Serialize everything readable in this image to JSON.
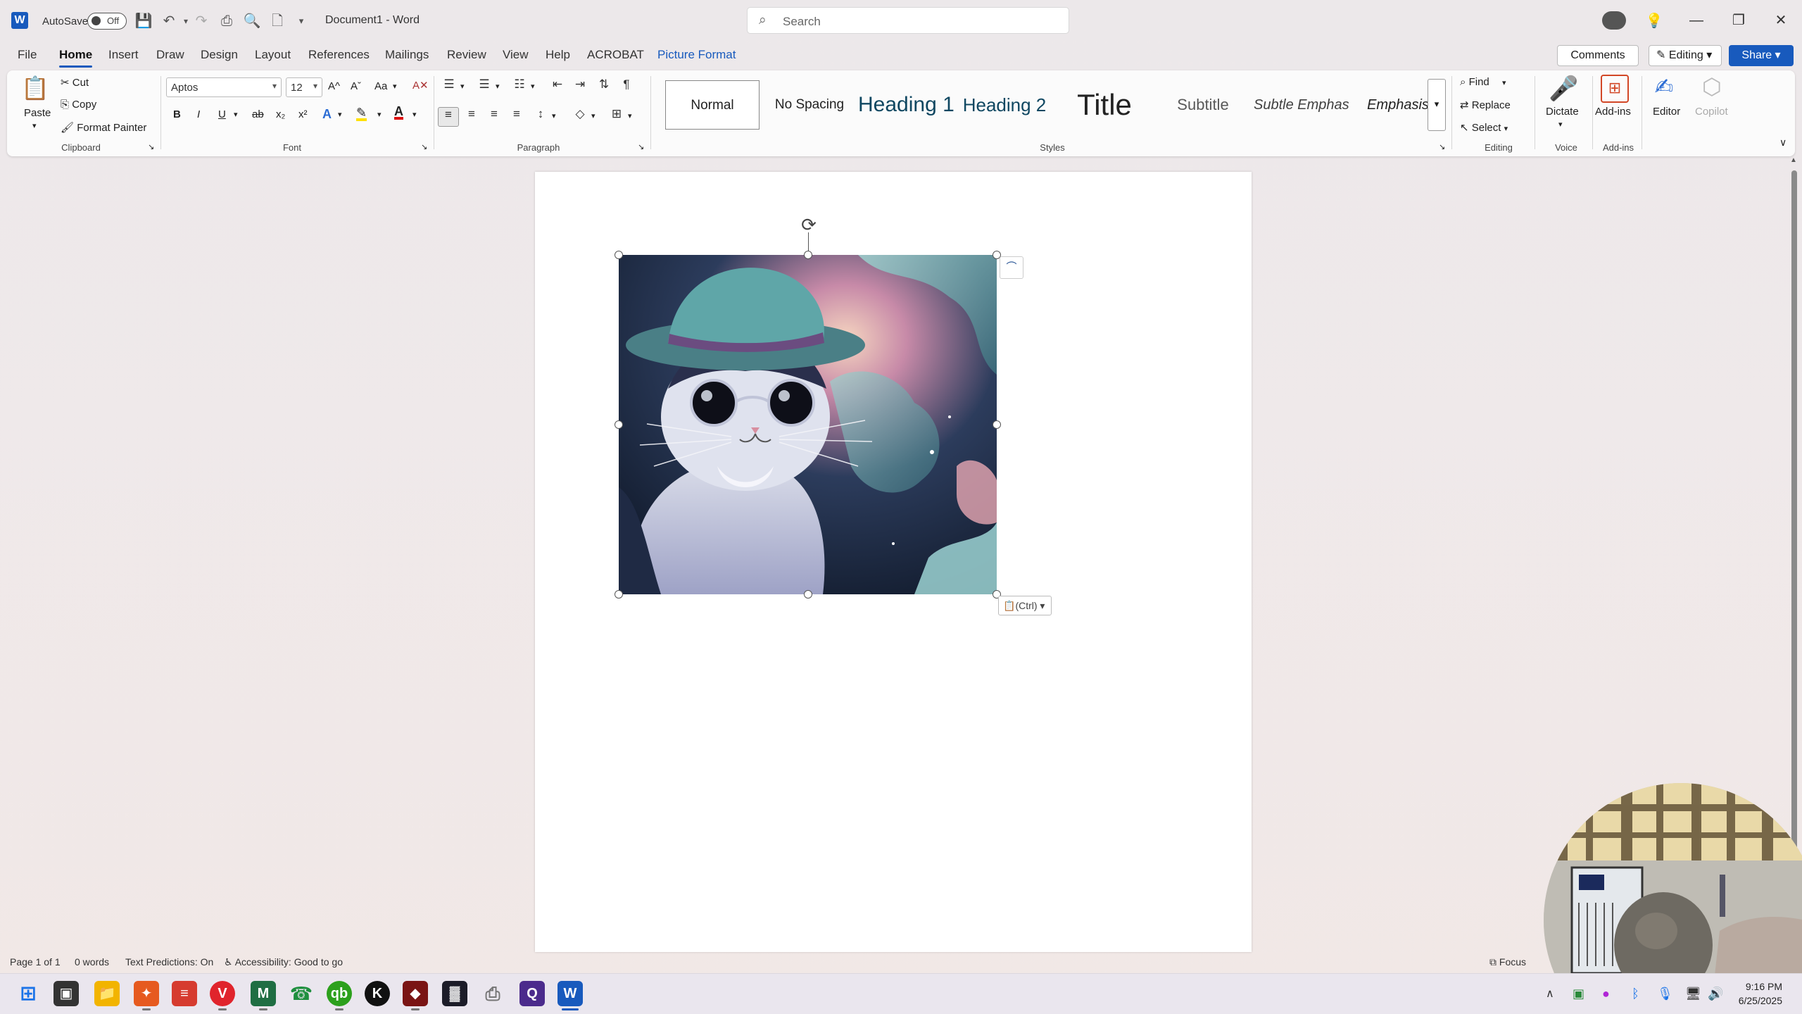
{
  "titlebar": {
    "autosave_label": "AutoSave",
    "autosave_state": "Off",
    "doc_title": "Document1  -  Word",
    "search_placeholder": "Search"
  },
  "menu": {
    "tabs": [
      "File",
      "Home",
      "Insert",
      "Draw",
      "Design",
      "Layout",
      "References",
      "Mailings",
      "Review",
      "View",
      "Help",
      "ACROBAT",
      "Picture Format"
    ],
    "active_tab": "Home",
    "comments": "Comments",
    "editing": "Editing",
    "share": "Share"
  },
  "ribbon": {
    "clipboard": {
      "paste": "Paste",
      "cut": "Cut",
      "copy": "Copy",
      "format_painter": "Format Painter",
      "label": "Clipboard"
    },
    "font": {
      "name": "Aptos",
      "size": "12",
      "label": "Font",
      "bold": "B",
      "italic": "I",
      "underline": "U",
      "strike": "ab",
      "sub": "x₂",
      "sup": "x²",
      "grow": "A^",
      "shrink": "Aˇ",
      "case": "Aa"
    },
    "paragraph": {
      "label": "Paragraph"
    },
    "styles": {
      "label": "Styles",
      "items": [
        "Normal",
        "No Spacing",
        "Heading 1",
        "Heading 2",
        "Title",
        "Subtitle",
        "Subtle Emphasis",
        "Emphasis"
      ]
    },
    "editing": {
      "find": "Find",
      "replace": "Replace",
      "select": "Select",
      "label": "Editing"
    },
    "voice": {
      "dictate": "Dictate",
      "label": "Voice"
    },
    "addins": {
      "addins": "Add-ins",
      "label": "Add-ins"
    },
    "editor": "Editor",
    "copilot": "Copilot"
  },
  "document": {
    "paste_options": "(Ctrl)"
  },
  "statusbar": {
    "page": "Page 1 of 1",
    "words": "0 words",
    "predictions": "Text Predictions: On",
    "accessibility": "Accessibility: Good to go",
    "focus": "Focus"
  },
  "taskbar": {
    "time": "9:16 PM",
    "date": "6/25/2025"
  },
  "colors": {
    "accent": "#185abd",
    "page": "#ffffff",
    "ribbon": "#fbfbfb"
  }
}
